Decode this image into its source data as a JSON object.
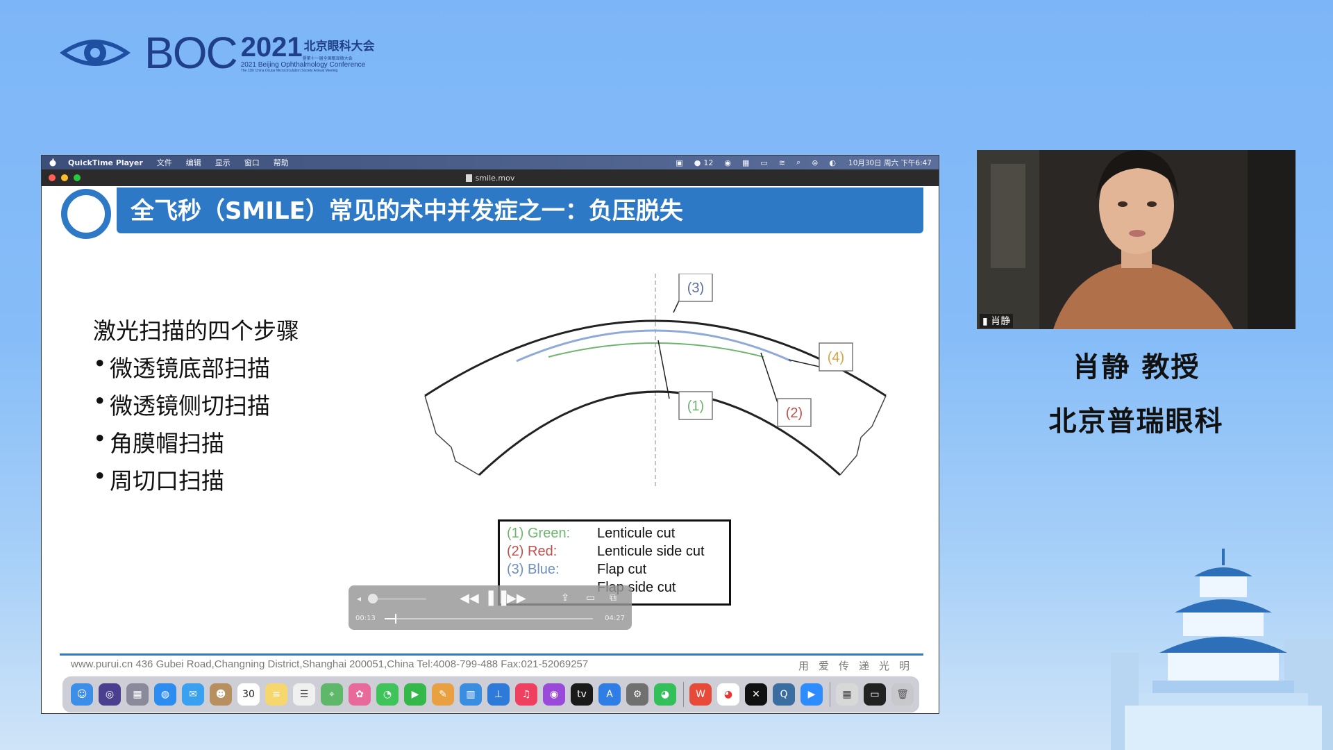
{
  "conference": {
    "brand": "BOC",
    "year": "2021",
    "name_cn": "北京眼科大会",
    "name_cn_sub": "暨第十一届全国眼显微大会",
    "name_en": "2021 Beijing Ophthalmology Conference",
    "name_en_sub": "The 11th China Ocular Microcirculation Society Annual Meeting"
  },
  "menubar": {
    "app": "QuickTime Player",
    "items": [
      "文件",
      "编辑",
      "显示",
      "窗口",
      "帮助"
    ],
    "wechat_count": "12",
    "clock": "10月30日 周六 下午6:47"
  },
  "window": {
    "title": "smile.mov"
  },
  "slide": {
    "title": "全飞秒（SMILE）常见的术中并发症之一：负压脱失",
    "steps_title": "激光扫描的四个步骤",
    "steps": [
      "微透镜底部扫描",
      "微透镜侧切扫描",
      "角膜帽扫描",
      "周切口扫描"
    ],
    "diagram_labels": [
      "(3)",
      "(4)",
      "(1)",
      "(2)"
    ],
    "legend": [
      {
        "key": "(1) Green:",
        "value": "Lenticule cut",
        "color": "#6fb56f"
      },
      {
        "key": "(2) Red:",
        "value": "Lenticule side cut",
        "color": "#c0504d"
      },
      {
        "key": "(3) Blue:",
        "value": "Flap cut",
        "color": "#6f8fc0"
      },
      {
        "key": "",
        "value": "Flap side cut",
        "color": "#d9a441"
      }
    ],
    "footer": "www.purui.cn    436 Gubei Road,Changning District,Shanghai 200051,China   Tel:4008-799-488   Fax:021-52069257",
    "motto": "用爱传递光明"
  },
  "player": {
    "current_time": "00:13",
    "total_time": "04:27",
    "progress": 0.05
  },
  "dock": {
    "calendar_day": "30"
  },
  "speaker": {
    "video_label": "肖静",
    "name": "肖静 教授",
    "org": "北京普瑞眼科"
  },
  "colors": {
    "slide_accent": "#2e79c6",
    "background": "#7db6f8"
  }
}
